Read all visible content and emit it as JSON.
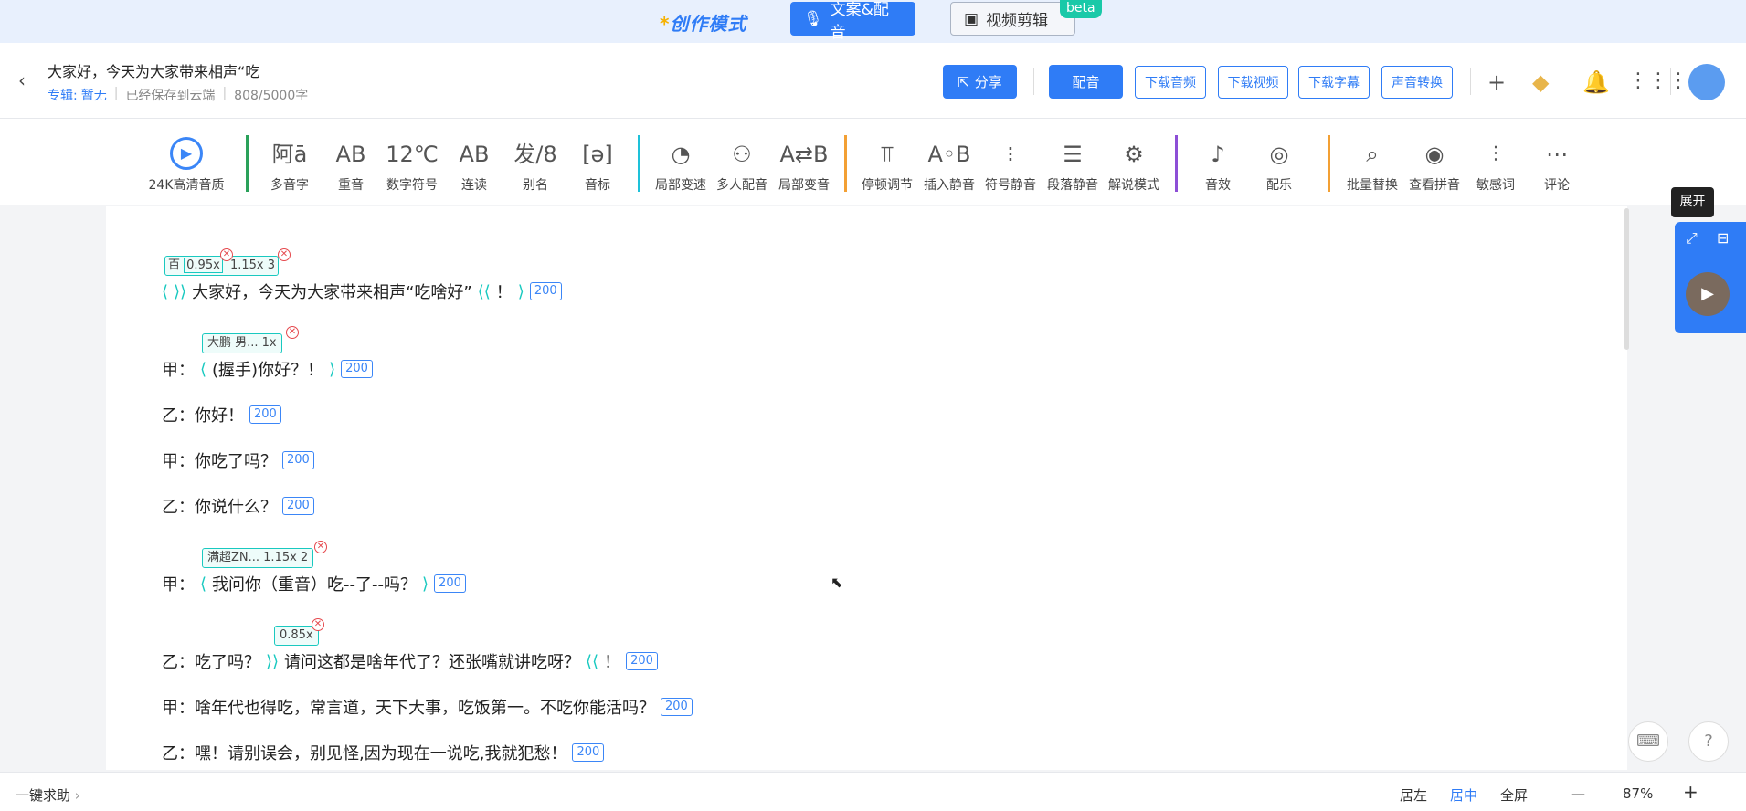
{
  "topbar": {
    "brand": "创作模式",
    "tab_active": "文案&配音",
    "tab_video": "视频剪辑",
    "beta": "beta"
  },
  "header": {
    "title": "大家好，今天为大家带来相声“吃",
    "album_label": "专辑:",
    "album_value": "暂无",
    "save_status": "已经保存到云端",
    "word_count": "808/5000字",
    "share": "分享",
    "dub": "配音",
    "download_audio": "下载音频",
    "download_video": "下载视频",
    "download_subtitle": "下载字幕",
    "voice_convert": "声音转换"
  },
  "toolbar": {
    "hd": "24K高清音质",
    "items": [
      "多音字",
      "重音",
      "数字符号",
      "连读",
      "别名",
      "音标",
      "局部变速",
      "多人配音",
      "局部变音",
      "停顿调节",
      "插入静音",
      "符号静音",
      "段落静音",
      "解说模式",
      "音效",
      "配乐",
      "批量替换",
      "查看拼音",
      "敏感词",
      "评论"
    ],
    "icons": [
      "阿ā",
      "AB",
      "12℃",
      "AB",
      "发/8",
      "[ə]",
      "◔",
      "⚇",
      "A⇄B",
      "⫪",
      "A◦B",
      "⁝",
      "☰",
      "⚙",
      "♪",
      "◎",
      "⌕",
      "◉",
      "⫶",
      "⋯"
    ]
  },
  "tags": {
    "t1_a": "百",
    "t1_b": "0.95x",
    "t1_c": "1.15x 3",
    "t2": "大鹏 男... 1x",
    "t3": "满超ZN... 1.15x 2",
    "t4": "0.85x"
  },
  "lines": [
    {
      "text": "大家好，今天为大家带来相声“吃啥好”",
      "badge": "200",
      "tail": "！"
    },
    {
      "text": "甲：",
      "mid": "(握手)你好？！",
      "badge": "200"
    },
    {
      "text": "乙：你好！",
      "badge": "200"
    },
    {
      "text": "甲：你吃了吗？",
      "badge": "200"
    },
    {
      "text": "乙：你说什么？",
      "badge": "200"
    },
    {
      "text": "甲：",
      "mid": "我问你（重音）吃--了--吗？",
      "badge": "200"
    },
    {
      "text": "乙：吃了吗？",
      "mid": "请问这都是啥年代了？还张嘴就讲吃呀？",
      "tail": "！",
      "badge": "200"
    },
    {
      "text": "甲：啥年代也得吃，常言道，天下大事，吃饭第一。不吃你能活吗？",
      "badge": "200"
    },
    {
      "text": "乙：嘿！请别误会，别见怪,因为现在一说吃,我就犯愁！",
      "badge": "200"
    }
  ],
  "side": {
    "tooltip": "展开"
  },
  "footer": {
    "help": "一键求助",
    "left": "居左",
    "center": "居中",
    "full": "全屏",
    "zoom": "87%",
    "minus": "—",
    "plus": "+"
  }
}
